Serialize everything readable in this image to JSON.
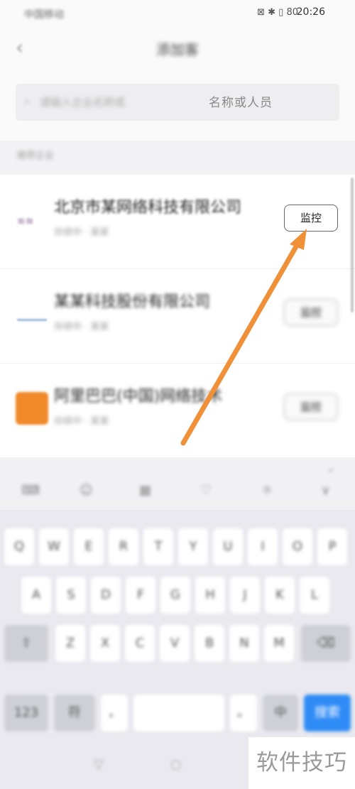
{
  "status": {
    "carrier": "中国移动",
    "icons": "⊠ ✱ ▯ 80",
    "time": "20:26"
  },
  "header": {
    "title": "添加客"
  },
  "search": {
    "placeholder_blur": "请输入企业名称或",
    "placeholder_clear": "名称或人员"
  },
  "section": {
    "label": "推荐企业"
  },
  "rows": [
    {
      "name": "北京市某网络科技有限公司",
      "sub": "存续中 · 某某",
      "button": "监控",
      "logo_color": "#8a6a9a"
    },
    {
      "name": "某某科技股份有限公司",
      "sub": "存续中 · 某某",
      "button": "监控",
      "logo_color": "#7aa0cf"
    },
    {
      "name": "阿里巴巴(中国)网络技术",
      "sub": "存续中 · 某某",
      "button": "监控",
      "logo_color": "#f08a2a"
    }
  ],
  "toolbar": {
    "tools": [
      "⌨",
      "☺",
      "▦",
      "♡",
      "☼",
      "∨"
    ],
    "collapse": "⌄"
  },
  "keyboard": {
    "row1": [
      "Q",
      "W",
      "E",
      "R",
      "T",
      "Y",
      "U",
      "I",
      "O",
      "P"
    ],
    "row2": [
      "A",
      "S",
      "D",
      "F",
      "G",
      "H",
      "J",
      "K",
      "L"
    ],
    "row3": [
      "Z",
      "X",
      "C",
      "V",
      "B",
      "N",
      "M"
    ],
    "shift": "⇧",
    "backspace": "⌫",
    "symbols": "符",
    "num": "123",
    "comma": "，",
    "space": "",
    "period": "。",
    "lang": "中",
    "enter": "搜索"
  },
  "nav": {
    "back": "▽",
    "home": "○",
    "recent": "□"
  },
  "watermark": "软件技巧",
  "colors": {
    "accent": "#2f8cf6",
    "arrow": "#f0913a"
  }
}
